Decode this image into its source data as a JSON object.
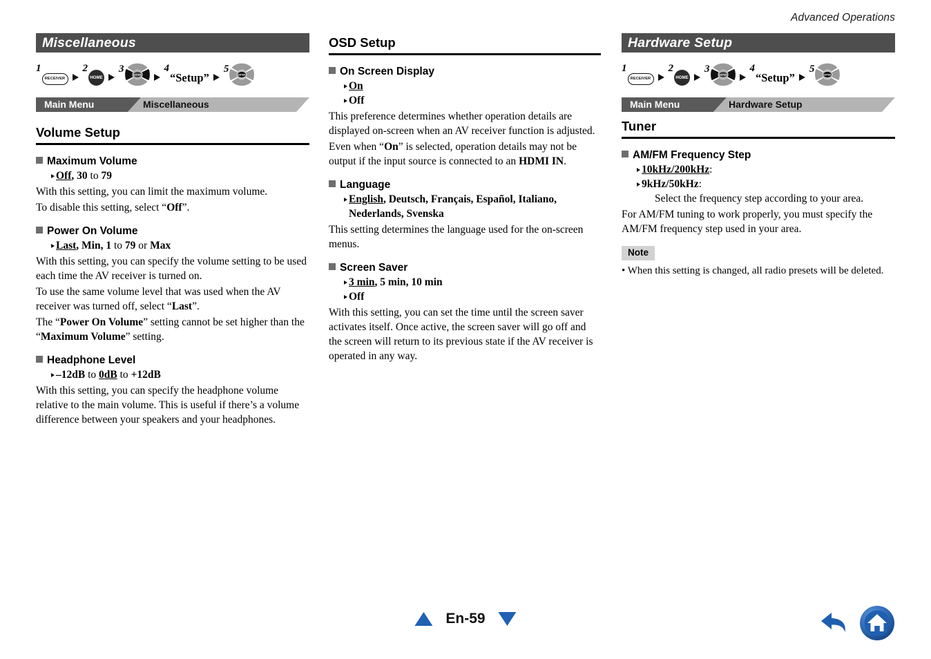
{
  "running_head": "Advanced Operations",
  "columns": {
    "left": {
      "banner": "Miscellaneous",
      "steps": [
        {
          "num": "1",
          "icon": "receiver-button-icon",
          "label": "RECEIVER"
        },
        {
          "num": "2",
          "icon": "home-button-icon",
          "label": "HOME"
        },
        {
          "num": "3",
          "icon": "dpad-left-right-icon",
          "label": "ENTER"
        },
        {
          "num": "4",
          "icon": "text-label",
          "label": "“Setup”"
        },
        {
          "num": "5",
          "icon": "dpad-enter-icon",
          "label": "ENTER"
        }
      ],
      "breadcrumb": {
        "root": "Main Menu",
        "current": "Miscellaneous"
      },
      "section_heading": "Volume Setup",
      "items": [
        {
          "title": "Maximum Volume",
          "options": [
            {
              "parts": [
                {
                  "t": "Off",
                  "s": "u"
                },
                {
                  "t": ", ",
                  "s": "b"
                },
                {
                  "t": "30",
                  "s": "b"
                },
                {
                  "t": " to ",
                  "s": "reg"
                },
                {
                  "t": "79",
                  "s": "b"
                }
              ]
            }
          ],
          "paragraphs": [
            [
              {
                "t": "With this setting, you can limit the maximum volume.",
                "s": "reg"
              }
            ],
            [
              {
                "t": "To disable this setting, select “",
                "s": "reg"
              },
              {
                "t": "Off",
                "s": "b"
              },
              {
                "t": "”.",
                "s": "reg"
              }
            ]
          ]
        },
        {
          "title": "Power On Volume",
          "options": [
            {
              "parts": [
                {
                  "t": "Last",
                  "s": "u"
                },
                {
                  "t": ", ",
                  "s": "b"
                },
                {
                  "t": "Min",
                  "s": "b"
                },
                {
                  "t": ", ",
                  "s": "b"
                },
                {
                  "t": "1",
                  "s": "b"
                },
                {
                  "t": " to ",
                  "s": "reg"
                },
                {
                  "t": "79",
                  "s": "b"
                },
                {
                  "t": " or ",
                  "s": "reg"
                },
                {
                  "t": "Max",
                  "s": "b"
                }
              ]
            }
          ],
          "paragraphs": [
            [
              {
                "t": "With this setting, you can specify the volume setting to be used each time the AV receiver is turned on.",
                "s": "reg"
              }
            ],
            [
              {
                "t": "To use the same volume level that was used when the AV receiver was turned off, select “",
                "s": "reg"
              },
              {
                "t": "Last",
                "s": "b"
              },
              {
                "t": "”.",
                "s": "reg"
              }
            ],
            [
              {
                "t": "The “",
                "s": "reg"
              },
              {
                "t": "Power On Volume",
                "s": "b"
              },
              {
                "t": "” setting cannot be set higher than the “",
                "s": "reg"
              },
              {
                "t": "Maximum Volume",
                "s": "b"
              },
              {
                "t": "” setting.",
                "s": "reg"
              }
            ]
          ]
        },
        {
          "title": "Headphone Level",
          "options": [
            {
              "parts": [
                {
                  "t": "–12dB",
                  "s": "b"
                },
                {
                  "t": " to ",
                  "s": "reg"
                },
                {
                  "t": "0dB",
                  "s": "u"
                },
                {
                  "t": " to ",
                  "s": "reg"
                },
                {
                  "t": "+12dB",
                  "s": "b"
                }
              ]
            }
          ],
          "paragraphs": [
            [
              {
                "t": "With this setting, you can specify the headphone volume relative to the main volume. This is useful if there’s a volume difference between your speakers and your headphones.",
                "s": "reg"
              }
            ]
          ]
        }
      ]
    },
    "middle": {
      "section_heading": "OSD Setup",
      "items": [
        {
          "title": "On Screen Display",
          "options": [
            {
              "parts": [
                {
                  "t": "On",
                  "s": "u"
                }
              ]
            },
            {
              "parts": [
                {
                  "t": "Off",
                  "s": "b"
                }
              ]
            }
          ],
          "paragraphs": [
            [
              {
                "t": "This preference determines whether operation details are displayed on-screen when an AV receiver function is adjusted.",
                "s": "reg"
              }
            ],
            [
              {
                "t": "Even when “",
                "s": "reg"
              },
              {
                "t": "On",
                "s": "b"
              },
              {
                "t": "” is selected, operation details may not be output if the input source is connected to an ",
                "s": "reg"
              },
              {
                "t": "HDMI IN",
                "s": "b"
              },
              {
                "t": ".",
                "s": "reg"
              }
            ]
          ]
        },
        {
          "title": "Language",
          "options": [
            {
              "parts": [
                {
                  "t": "English",
                  "s": "u"
                },
                {
                  "t": ", Deutsch, Français, Español, Italiano,",
                  "s": "b"
                }
              ],
              "cont": "Nederlands, Svenska"
            }
          ],
          "paragraphs": [
            [
              {
                "t": "This setting determines the language used for the on-screen menus.",
                "s": "reg"
              }
            ]
          ]
        },
        {
          "title": "Screen Saver",
          "options": [
            {
              "parts": [
                {
                  "t": "3 min",
                  "s": "u"
                },
                {
                  "t": ", 5 min, 10 min",
                  "s": "b"
                }
              ]
            },
            {
              "parts": [
                {
                  "t": "Off",
                  "s": "b"
                }
              ]
            }
          ],
          "paragraphs": [
            [
              {
                "t": "With this setting, you can set the time until the screen saver activates itself. Once active, the screen saver will go off and the screen will return to its previous state if the AV receiver is operated in any way.",
                "s": "reg"
              }
            ]
          ]
        }
      ]
    },
    "right": {
      "banner": "Hardware Setup",
      "steps": [
        {
          "num": "1",
          "icon": "receiver-button-icon",
          "label": "RECEIVER"
        },
        {
          "num": "2",
          "icon": "home-button-icon",
          "label": "HOME"
        },
        {
          "num": "3",
          "icon": "dpad-left-right-icon",
          "label": "ENTER"
        },
        {
          "num": "4",
          "icon": "text-label",
          "label": "“Setup”"
        },
        {
          "num": "5",
          "icon": "dpad-enter-icon",
          "label": "ENTER"
        }
      ],
      "breadcrumb": {
        "root": "Main Menu",
        "current": "Hardware Setup"
      },
      "section_heading": "Tuner",
      "items": [
        {
          "title": "AM/FM Frequency Step",
          "options": [
            {
              "parts": [
                {
                  "t": "10kHz/200kHz",
                  "s": "u"
                },
                {
                  "t": ":",
                  "s": "reg"
                }
              ]
            },
            {
              "parts": [
                {
                  "t": "9kHz/50kHz",
                  "s": "b"
                },
                {
                  "t": ":",
                  "s": "reg"
                }
              ],
              "sub": "Select the frequency step according to your area."
            }
          ],
          "paragraphs": [
            [
              {
                "t": "For AM/FM tuning to work properly, you must specify the AM/FM frequency step used in your area.",
                "s": "reg"
              }
            ]
          ]
        }
      ],
      "note": {
        "badge": "Note",
        "items": [
          "• When this setting is changed, all radio presets will be deleted."
        ]
      }
    }
  },
  "footer": {
    "page_label": "En-59",
    "prev_icon": "triangle-up-icon",
    "next_icon": "triangle-down-icon",
    "back_icon": "back-arrow-icon",
    "home_icon": "home-icon"
  },
  "colors": {
    "banner_bg": "#4e4e4e",
    "crumb_dark": "#5a5a5a",
    "crumb_light": "#b4b4b4",
    "bullet_grey": "#6e6e6e",
    "note_bg": "#d2d2d2",
    "accent_blue": "#1f61b5"
  }
}
